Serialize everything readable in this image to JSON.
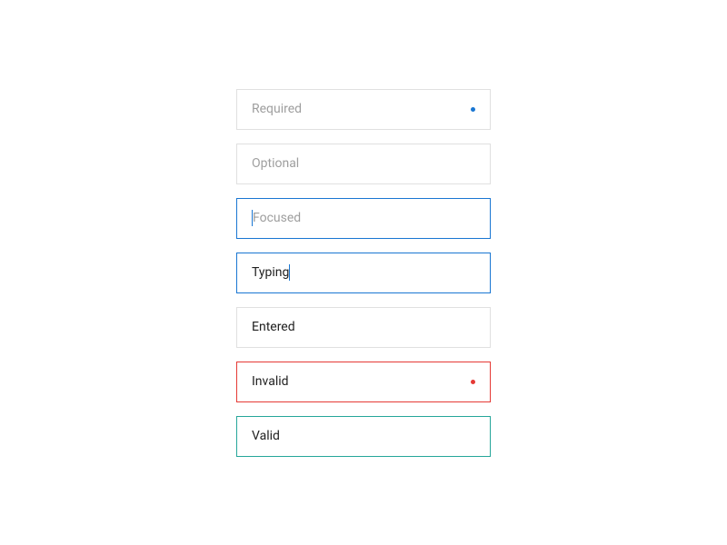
{
  "fields": {
    "required": {
      "placeholder": "Required"
    },
    "optional": {
      "placeholder": "Optional"
    },
    "focused": {
      "placeholder": "Focused"
    },
    "typing": {
      "value": "Typing"
    },
    "entered": {
      "value": "Entered"
    },
    "invalid": {
      "value": "Invalid"
    },
    "valid": {
      "value": "Valid"
    }
  },
  "colors": {
    "border_default": "#e0e0e0",
    "border_focused": "#1976d2",
    "border_invalid": "#e53935",
    "border_valid": "#26a69a",
    "text_placeholder": "#9e9e9e",
    "text_entered": "#212121"
  }
}
